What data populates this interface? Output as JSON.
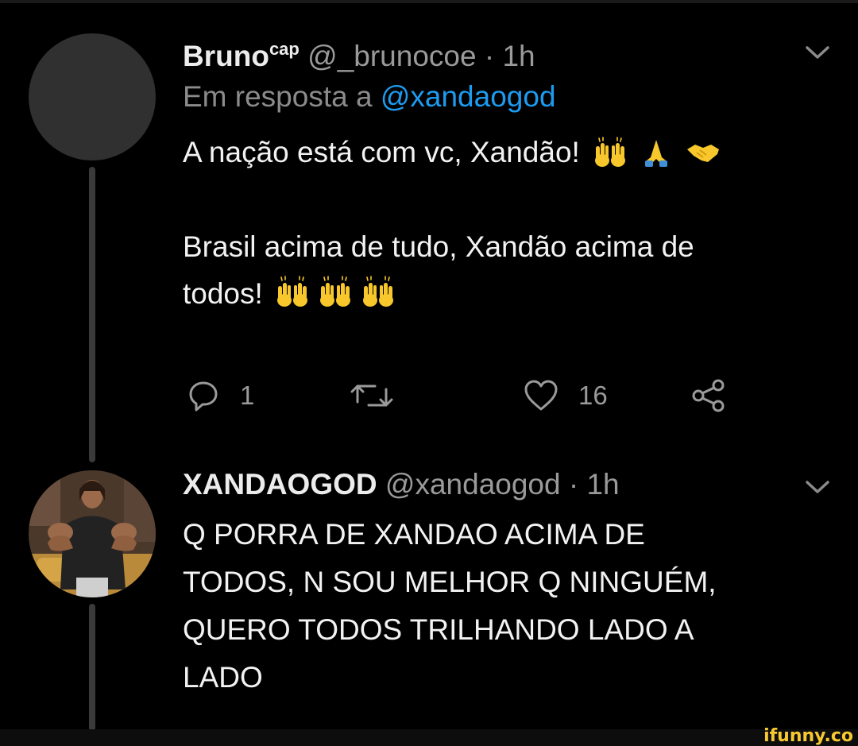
{
  "tweet": {
    "display_name": "Bruno",
    "name_superscript": "cap",
    "handle_time": "@_brunocoe · 1h",
    "reply_prefix": "Em resposta a ",
    "reply_mention": "@xandaogod",
    "line1": "A nação está com vc, Xandão!",
    "line2": "Brasil acima de tudo, Xandão acima de",
    "line3": "todos!",
    "reply_count": "1",
    "like_count": "16"
  },
  "reply": {
    "display_name": "XANDAOGOD",
    "handle_time": "@xandaogod · 1h",
    "lines": [
      "Q PORRA DE XANDAO ACIMA DE",
      "TODOS, N SOU MELHOR Q NINGUÉM,",
      "QUERO TODOS TRILHANDO LADO A",
      "LADO"
    ]
  },
  "watermark": "ifunny.co",
  "icons": [
    "chevron-down-icon",
    "raising-hands-emoji",
    "folded-hands-emoji",
    "handshake-emoji",
    "reply-icon",
    "retweet-icon",
    "like-heart-icon",
    "share-icon"
  ],
  "colors": {
    "background": "#000000",
    "mention": "#1d9bf0",
    "muted": "#9a9a9a",
    "emoji": "#f7c72c",
    "watermark": "#f7c92f"
  }
}
